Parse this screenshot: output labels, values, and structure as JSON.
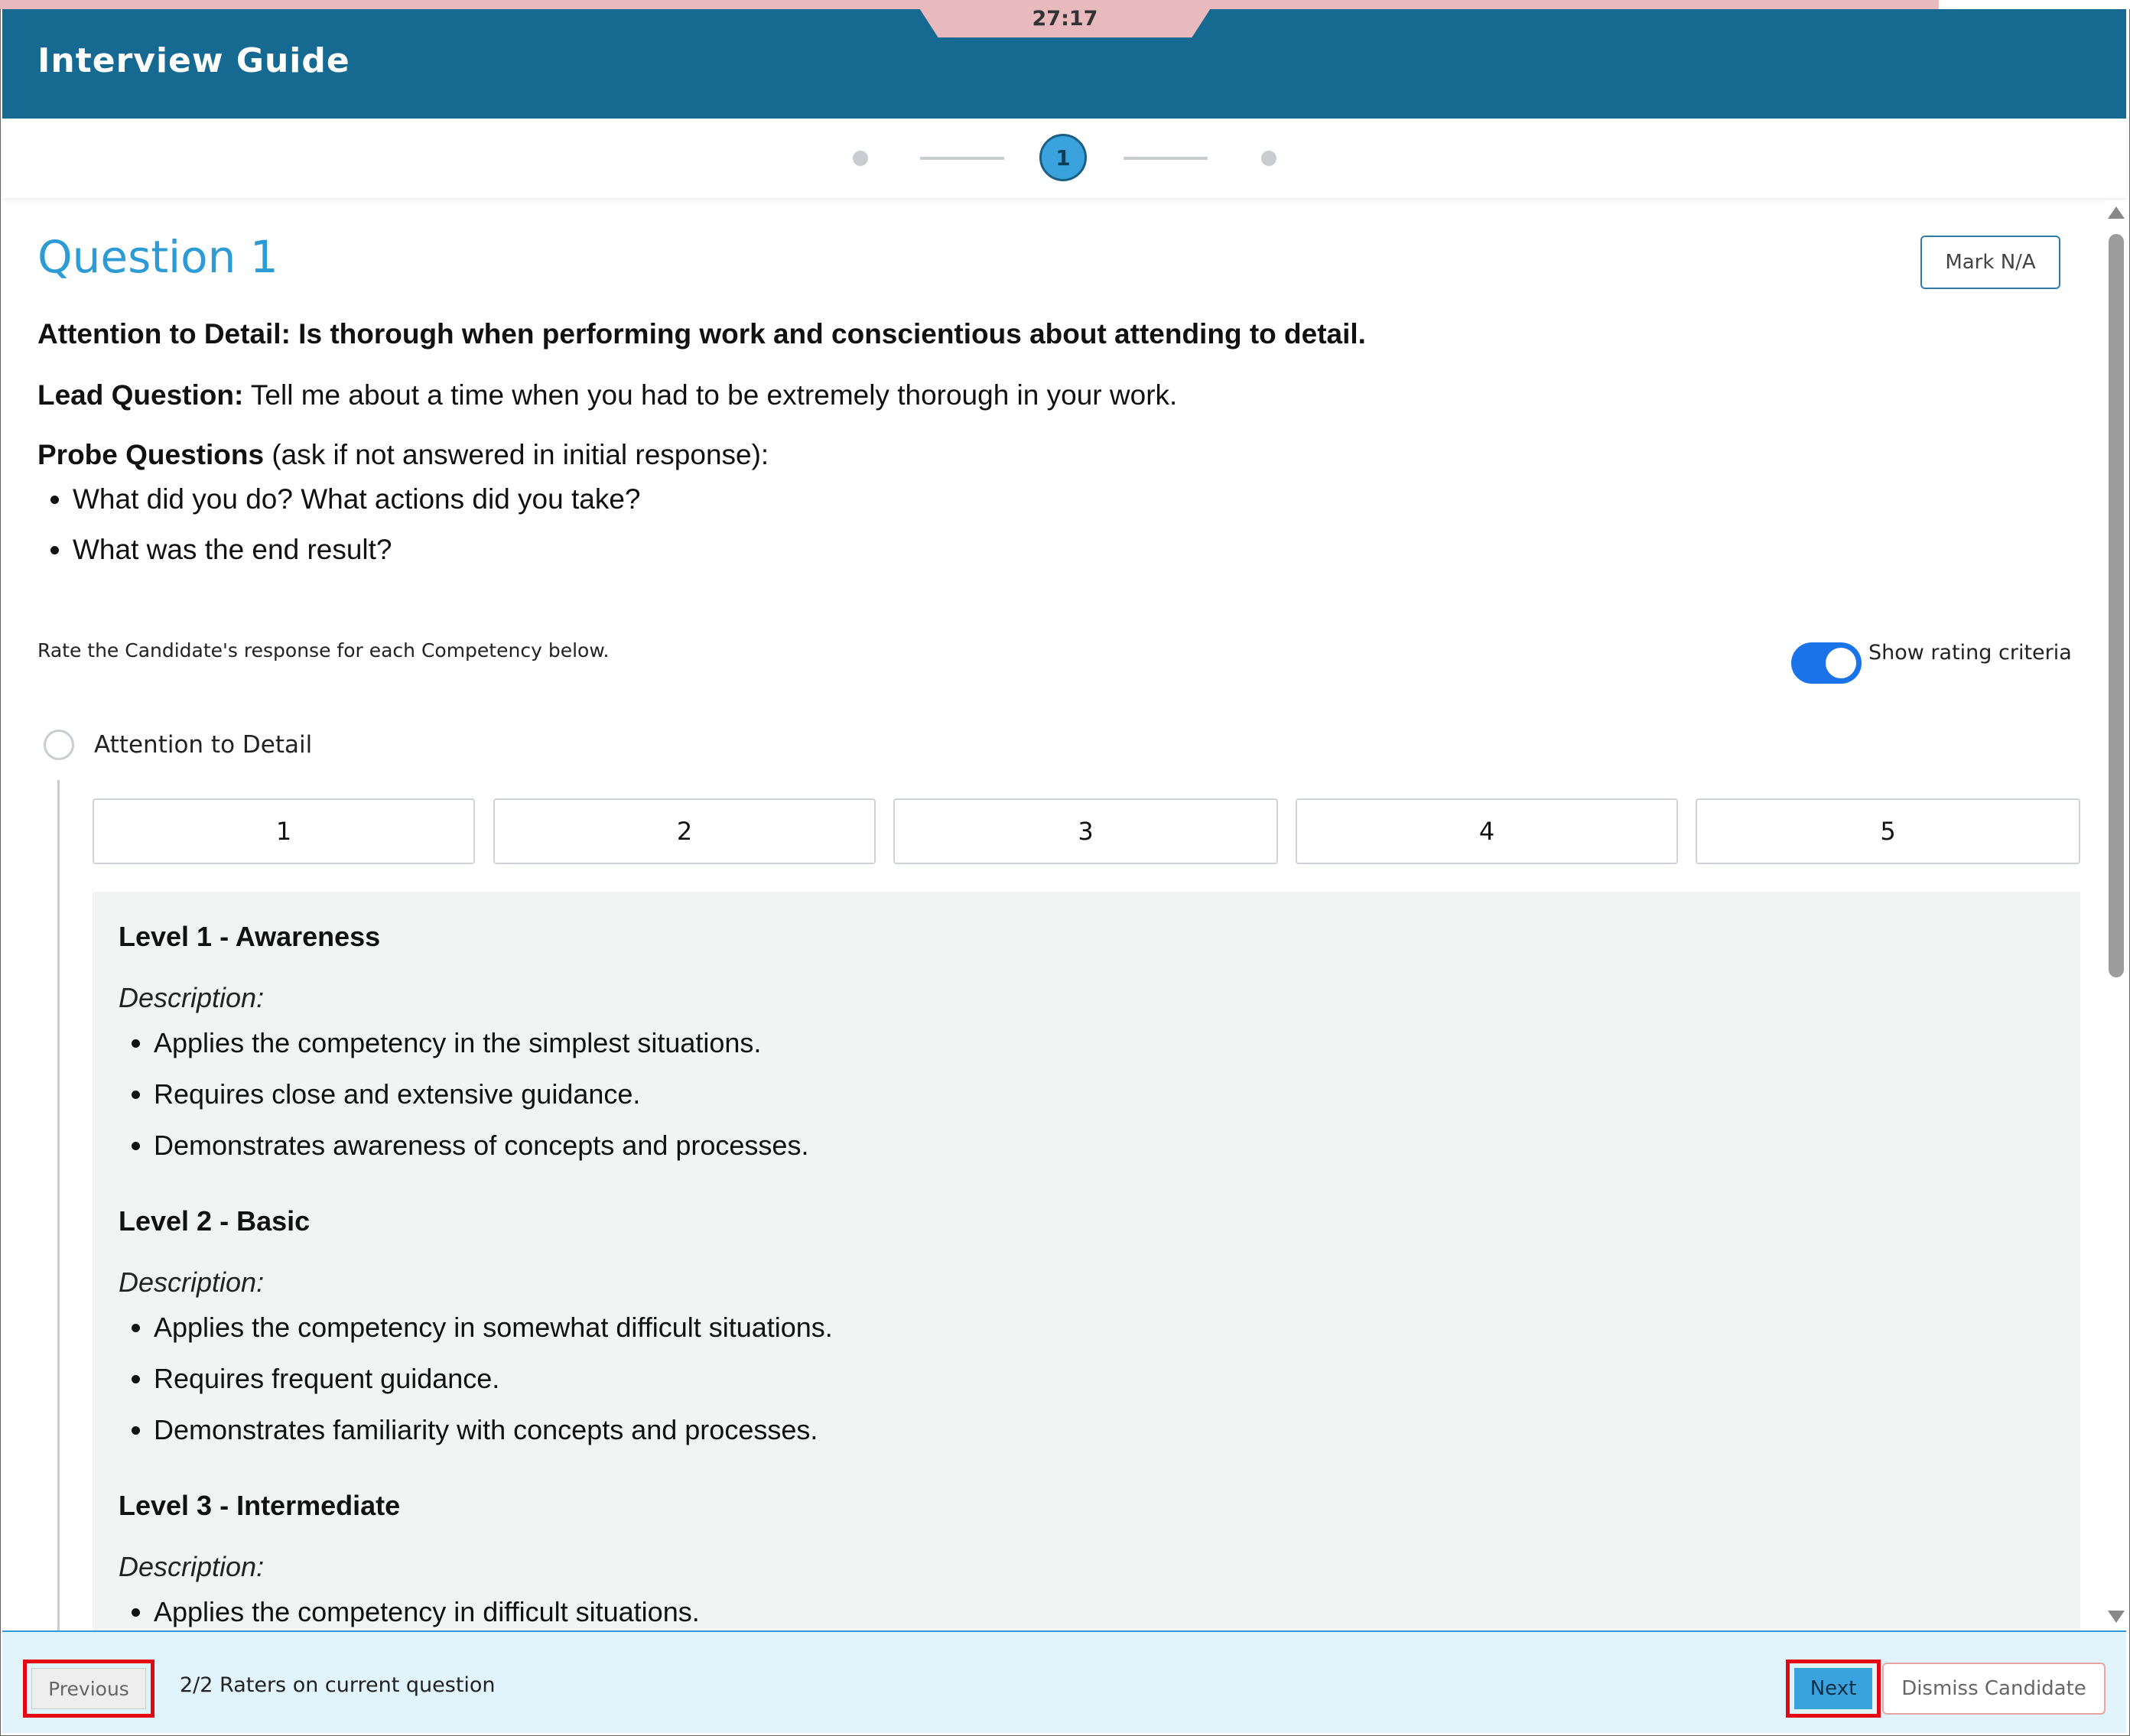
{
  "timer": "27:17",
  "header": {
    "title": "Interview Guide"
  },
  "stepper": {
    "current": "1"
  },
  "question": {
    "title": "Question 1",
    "mark_na_label": "Mark N/A",
    "competency_statement": "Attention to Detail: Is thorough when performing work and conscientious about attending to detail.",
    "lead_label": "Lead Question:",
    "lead_text": " Tell me about a time when you had to be extremely thorough in your work.",
    "probe_label": "Probe Questions",
    "probe_text": " (ask if not answered in initial response):",
    "probes": [
      "What did you do? What actions did you take?",
      "What was the end result?"
    ]
  },
  "rating": {
    "instruction": "Rate the Candidate's response for each Competency below.",
    "toggle_label": "Show rating criteria",
    "toggle_on": true,
    "competency": "Attention to Detail",
    "scale": [
      "1",
      "2",
      "3",
      "4",
      "5"
    ]
  },
  "criteria": {
    "levels": [
      {
        "title": "Level 1 - Awareness",
        "desc_label": "Description:",
        "items": [
          "Applies the competency in the simplest situations.",
          "Requires close and extensive guidance.",
          "Demonstrates awareness of concepts and processes."
        ]
      },
      {
        "title": "Level 2 - Basic",
        "desc_label": "Description:",
        "items": [
          "Applies the competency in somewhat difficult situations.",
          "Requires frequent guidance.",
          "Demonstrates familiarity with concepts and processes."
        ]
      },
      {
        "title": "Level 3 - Intermediate",
        "desc_label": "Description:",
        "items": [
          "Applies the competency in difficult situations."
        ]
      }
    ]
  },
  "footer": {
    "previous_label": "Previous",
    "raters_text": "2/2 Raters on current question",
    "next_label": "Next",
    "dismiss_label": "Dismiss Candidate"
  },
  "colors": {
    "header": "#166a91",
    "accent": "#2c9bd6",
    "toggle": "#1a73e8",
    "highlight": "#e30613"
  }
}
